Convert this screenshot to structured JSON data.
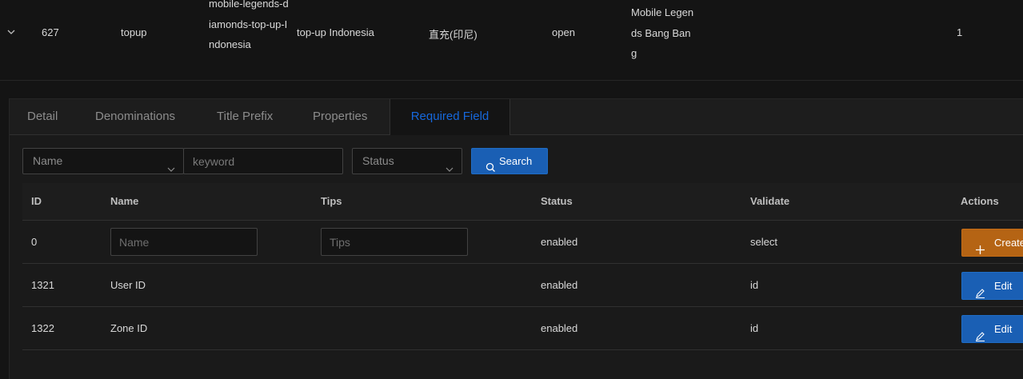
{
  "parent_row": {
    "id": "627",
    "type": "topup",
    "slug": "mobile-legends-diamonds-top-up-Indonesia",
    "title": "top-up Indonesia",
    "title_cn": "直充(印尼)",
    "status": "open",
    "game": "Mobile Legends Bang Bang",
    "count": "1"
  },
  "tabs": [
    {
      "label": "Detail"
    },
    {
      "label": "Denominations"
    },
    {
      "label": "Title Prefix"
    },
    {
      "label": "Properties"
    },
    {
      "label": "Required Field",
      "active": true
    }
  ],
  "filter": {
    "field_select": "Name",
    "keyword_placeholder": "keyword",
    "status_select": "Status",
    "search_label": "Search"
  },
  "table": {
    "headers": [
      "ID",
      "Name",
      "Tips",
      "Status",
      "Validate",
      "Actions"
    ],
    "new_row": {
      "id": "0",
      "name_placeholder": "Name",
      "tips_placeholder": "Tips",
      "status": "enabled",
      "validate": "select",
      "action_label": "Create"
    },
    "rows": [
      {
        "id": "1321",
        "name": "User ID",
        "tips": "",
        "status": "enabled",
        "validate": "id",
        "action_label": "Edit"
      },
      {
        "id": "1322",
        "name": "Zone ID",
        "tips": "",
        "status": "enabled",
        "validate": "id",
        "action_label": "Edit"
      }
    ]
  },
  "colors": {
    "accent_blue": "#1668dc",
    "primary_button": "#1a5fb4",
    "create_button": "#b56414"
  },
  "icons": {
    "expand": "chevron-down-icon",
    "select_arrow": "chevron-down-icon",
    "search": "search-icon",
    "create": "plus-icon",
    "edit": "edit-icon"
  }
}
